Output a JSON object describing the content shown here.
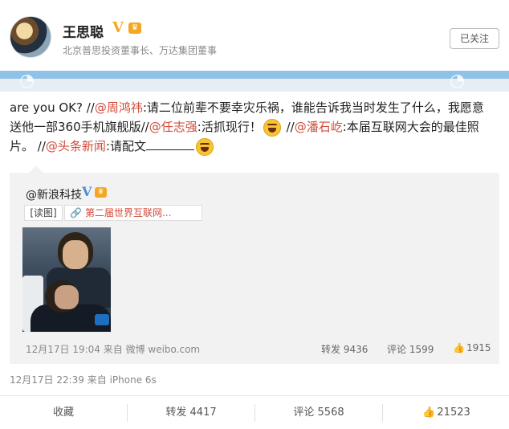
{
  "header": {
    "name": "王思聪",
    "verified_badge": "V",
    "bio": "北京普思投资董事长、万达集团董事",
    "follow_label": "已关注"
  },
  "post": {
    "seg1": "are you OK? //",
    "mention1": "@周鸿祎",
    "seg2": ":请二位前辈不要幸灾乐祸，谁能告诉我当时发生了什么，我愿意送他一部360手机旗舰版//",
    "mention2": "@任志强",
    "seg3": ":活抓现行！",
    "seg4": " //",
    "mention3": "@潘石屹",
    "seg5": ":本届互联网大会的最佳照片。 //",
    "mention4": "@头条新闻",
    "seg6": ":请配文"
  },
  "repost": {
    "author": "@新浪科技",
    "verified_badge": "V",
    "read_tag": "[读图]",
    "link_text": "第二届世界互联网...",
    "meta": "12月17日 19:04 来自 微博 weibo.com",
    "repost_count": "转发 9436",
    "comment_count": "评论 1599",
    "like_count": "1915"
  },
  "post_meta": "12月17日 22:39 来自 iPhone 6s",
  "actions": {
    "favorite": "收藏",
    "repost": "转发 4417",
    "comment": "评论 5568",
    "like": "21523"
  },
  "colors": {
    "mention": "#d14b3a",
    "band": "#8fc2e6",
    "badge_gold": "#f5a623",
    "badge_blue": "#4a8fd8"
  }
}
